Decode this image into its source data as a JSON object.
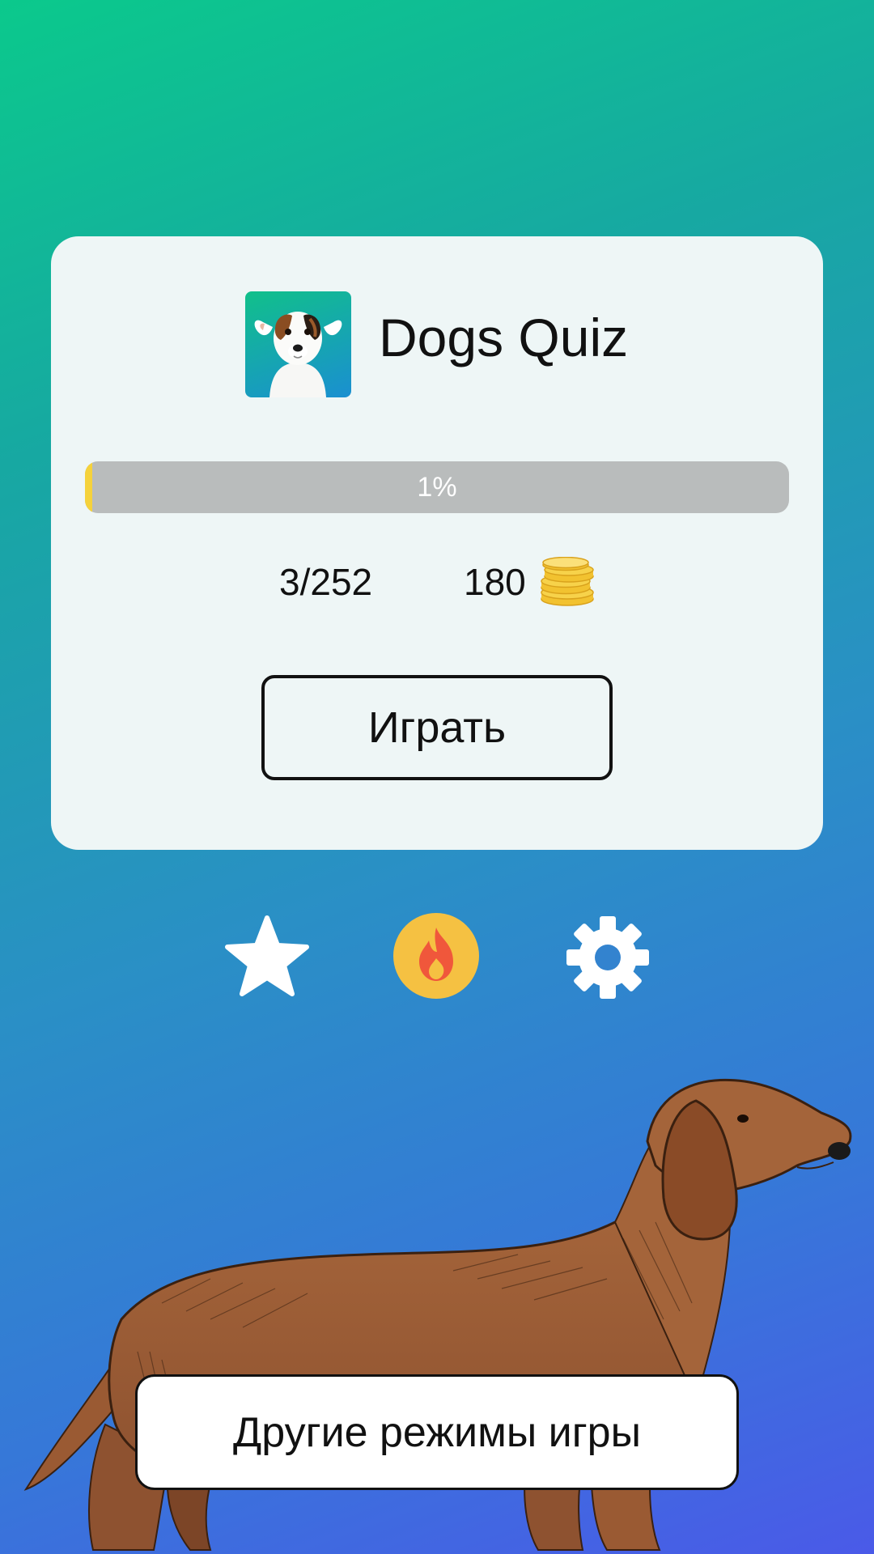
{
  "app": {
    "title": "Dogs Quiz",
    "icon": "dog-portrait-icon"
  },
  "progress": {
    "label": "1%",
    "value_percent": 1
  },
  "stats": {
    "levels": "3/252",
    "coins": "180",
    "coins_icon": "coin-stack-icon"
  },
  "buttons": {
    "play_label": "Играть",
    "other_modes_label": "Другие режимы игры"
  },
  "toolbar": {
    "favorites_icon": "star-icon",
    "hot_icon": "fire-icon",
    "settings_icon": "gear-icon"
  },
  "colors": {
    "progress_fill": "#f5d23b",
    "progress_track": "#b9bcbc",
    "hot_button_bg": "#f5c142",
    "fire": "#f0573b"
  }
}
